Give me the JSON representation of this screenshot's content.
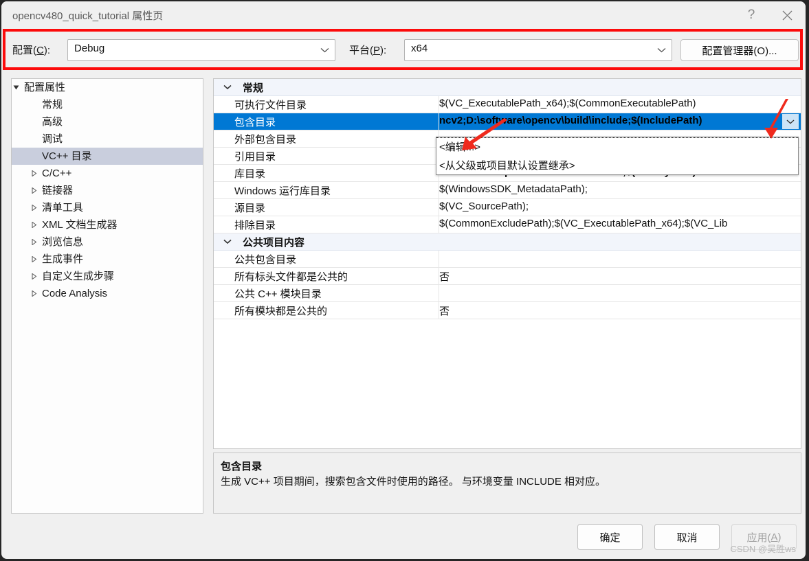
{
  "window": {
    "title": "opencv480_quick_tutorial 属性页",
    "help_button": "?",
    "close_button": "✕"
  },
  "toolbar": {
    "config_label_pre": "配置(",
    "config_label_key": "C",
    "config_label_post": "):",
    "config_value": "Debug",
    "platform_label_pre": "平台(",
    "platform_label_key": "P",
    "platform_label_post": "):",
    "platform_value": "x64",
    "config_manager_button": "配置管理器(O)...",
    "highlight_color": "#fc0b0b"
  },
  "tree": {
    "items": [
      {
        "label": "配置属性",
        "indent": 10,
        "expander": "down",
        "selected": false
      },
      {
        "label": "常规",
        "indent": 36,
        "expander": "none",
        "selected": false
      },
      {
        "label": "高级",
        "indent": 36,
        "expander": "none",
        "selected": false
      },
      {
        "label": "调试",
        "indent": 36,
        "expander": "none",
        "selected": false
      },
      {
        "label": "VC++ 目录",
        "indent": 36,
        "expander": "none",
        "selected": true
      },
      {
        "label": "C/C++",
        "indent": 36,
        "expander": "right",
        "selected": false
      },
      {
        "label": "链接器",
        "indent": 36,
        "expander": "right",
        "selected": false
      },
      {
        "label": "清单工具",
        "indent": 36,
        "expander": "right",
        "selected": false
      },
      {
        "label": "XML 文档生成器",
        "indent": 36,
        "expander": "right",
        "selected": false
      },
      {
        "label": "浏览信息",
        "indent": 36,
        "expander": "right",
        "selected": false
      },
      {
        "label": "生成事件",
        "indent": 36,
        "expander": "right",
        "selected": false
      },
      {
        "label": "自定义生成步骤",
        "indent": 36,
        "expander": "right",
        "selected": false
      },
      {
        "label": "Code Analysis",
        "indent": 36,
        "expander": "right",
        "selected": false
      }
    ]
  },
  "grid": {
    "rows": [
      {
        "kind": "section",
        "name": "常规",
        "value": "",
        "selected": false,
        "bold": false
      },
      {
        "kind": "prop",
        "name": "可执行文件目录",
        "value": "$(VC_ExecutablePath_x64);$(CommonExecutablePath)",
        "selected": false,
        "bold": false
      },
      {
        "kind": "prop",
        "name": "包含目录",
        "value": "ncv2;D:\\software\\opencv\\build\\include;$(IncludePath)",
        "selected": true,
        "bold": true
      },
      {
        "kind": "prop",
        "name": "外部包含目录",
        "value": "",
        "selected": false,
        "bold": false
      },
      {
        "kind": "prop",
        "name": "引用目录",
        "value": "",
        "selected": false,
        "bold": false
      },
      {
        "kind": "prop",
        "name": "库目录",
        "value": "D:\\software\\opencv\\build\\x64\\vc16\\lib;$(LibraryPath)",
        "selected": false,
        "bold": true
      },
      {
        "kind": "prop",
        "name": "Windows 运行库目录",
        "value": "$(WindowsSDK_MetadataPath);",
        "selected": false,
        "bold": false
      },
      {
        "kind": "prop",
        "name": "源目录",
        "value": "$(VC_SourcePath);",
        "selected": false,
        "bold": false
      },
      {
        "kind": "prop",
        "name": "排除目录",
        "value": "$(CommonExcludePath);$(VC_ExecutablePath_x64);$(VC_Lib",
        "selected": false,
        "bold": false
      },
      {
        "kind": "section",
        "name": "公共项目内容",
        "value": "",
        "selected": false,
        "bold": false
      },
      {
        "kind": "prop",
        "name": "公共包含目录",
        "value": "",
        "selected": false,
        "bold": false
      },
      {
        "kind": "prop",
        "name": "所有标头文件都是公共的",
        "value": "否",
        "selected": false,
        "bold": false
      },
      {
        "kind": "prop",
        "name": "公共 C++ 模块目录",
        "value": "",
        "selected": false,
        "bold": false
      },
      {
        "kind": "prop",
        "name": "所有模块都是公共的",
        "value": "否",
        "selected": false,
        "bold": false
      }
    ],
    "dropdown": {
      "items": [
        "<编辑...>",
        "<从父级或项目默认设置继承>"
      ]
    }
  },
  "description": {
    "title": "包含目录",
    "body": "生成 VC++ 项目期间，搜索包含文件时使用的路径。 与环境变量 INCLUDE 相对应。"
  },
  "footer": {
    "ok": "确定",
    "cancel": "取消",
    "apply_pre": "应用(",
    "apply_key": "A",
    "apply_post": ")"
  },
  "watermark": "CSDN @吴胜ws"
}
